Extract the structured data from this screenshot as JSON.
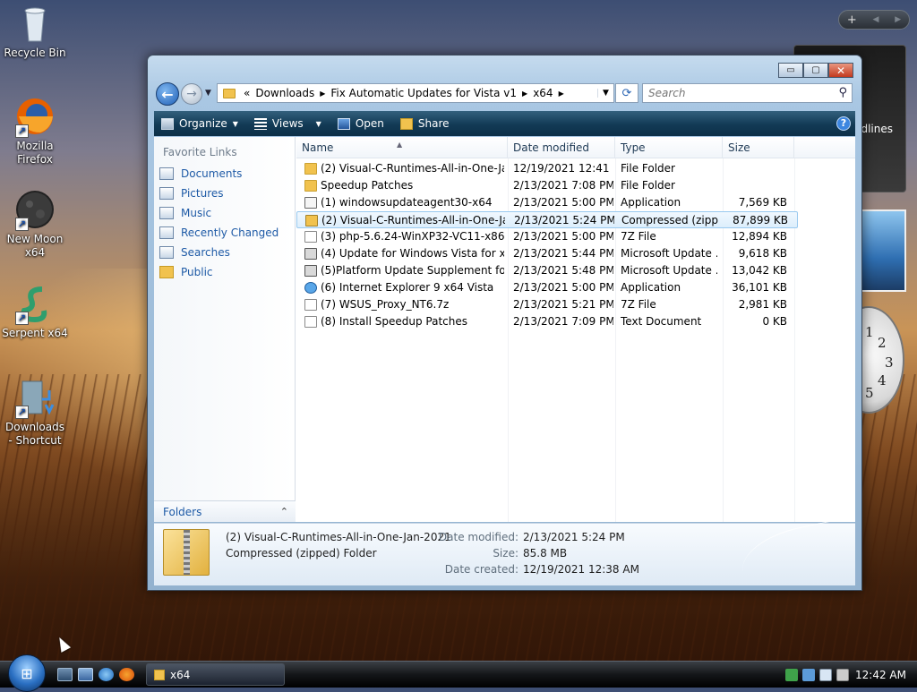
{
  "desktop": {
    "icons": [
      {
        "label": "Recycle Bin",
        "icon": "recycle-bin-icon"
      },
      {
        "label": "Mozilla Firefox",
        "icon": "firefox-icon"
      },
      {
        "label": "New Moon x64",
        "icon": "new-moon-icon"
      },
      {
        "label": "Serpent x64",
        "icon": "serpent-icon"
      },
      {
        "label": "Downloads - Shortcut",
        "icon": "downloads-shortcut-icon"
      }
    ],
    "gadget_text": "dlines",
    "clock_numbers": [
      "1",
      "2",
      "3",
      "4",
      "5"
    ]
  },
  "window": {
    "title_buttons": {
      "minimize": "▭",
      "maximize": "▢",
      "close": "✕"
    },
    "address": {
      "prefix": "«",
      "crumbs": [
        "Downloads",
        "Fix Automatic Updates for Vista v1",
        "x64"
      ]
    },
    "search_placeholder": "Search",
    "toolbar": {
      "organize": "Organize",
      "views": "Views",
      "open": "Open",
      "share": "Share",
      "help": "?"
    },
    "nav_pane": {
      "header": "Favorite Links",
      "links": [
        "Documents",
        "Pictures",
        "Music",
        "Recently Changed",
        "Searches",
        "Public"
      ],
      "folders_label": "Folders"
    },
    "columns": {
      "name": "Name",
      "date": "Date modified",
      "type": "Type",
      "size": "Size"
    },
    "files": [
      {
        "name": "(2) Visual-C-Runtimes-All-in-One-Ja...",
        "date": "12/19/2021 12:41 ...",
        "type": "File Folder",
        "size": "",
        "icon": "folder"
      },
      {
        "name": "Speedup Patches",
        "date": "2/13/2021 7:08 PM",
        "type": "File Folder",
        "size": "",
        "icon": "folder"
      },
      {
        "name": "(1) windowsupdateagent30-x64",
        "date": "2/13/2021 5:00 PM",
        "type": "Application",
        "size": "7,569 KB",
        "icon": "app"
      },
      {
        "name": "(2) Visual-C-Runtimes-All-in-One-Ja...",
        "date": "2/13/2021 5:24 PM",
        "type": "Compressed (zipp...",
        "size": "87,899 KB",
        "icon": "zip",
        "selected": true
      },
      {
        "name": "(3) php-5.6.24-WinXP32-VC11-x86.7z",
        "date": "2/13/2021 5:00 PM",
        "type": "7Z File",
        "size": "12,894 KB",
        "icon": "7z"
      },
      {
        "name": "(4) Update for Windows Vista for x64-...",
        "date": "2/13/2021 5:44 PM",
        "type": "Microsoft Update ...",
        "size": "9,618 KB",
        "icon": "msu"
      },
      {
        "name": "(5)Platform Update Supplement for ...",
        "date": "2/13/2021 5:48 PM",
        "type": "Microsoft Update ...",
        "size": "13,042 KB",
        "icon": "msu"
      },
      {
        "name": "(6) Internet Explorer 9 x64 Vista",
        "date": "2/13/2021 5:00 PM",
        "type": "Application",
        "size": "36,101 KB",
        "icon": "ie"
      },
      {
        "name": "(7) WSUS_Proxy_NT6.7z",
        "date": "2/13/2021 5:21 PM",
        "type": "7Z File",
        "size": "2,981 KB",
        "icon": "7z"
      },
      {
        "name": "(8) Install Speedup Patches",
        "date": "2/13/2021 7:09 PM",
        "type": "Text Document",
        "size": "0 KB",
        "icon": "txt"
      }
    ],
    "details": {
      "name": "(2) Visual-C-Runtimes-All-in-One-Jan-2021",
      "kind": "Compressed (zipped) Folder",
      "date_modified_label": "Date modified:",
      "date_modified": "2/13/2021 5:24 PM",
      "size_label": "Size:",
      "size": "85.8 MB",
      "date_created_label": "Date created:",
      "date_created": "12/19/2021 12:38 AM"
    }
  },
  "taskbar": {
    "task_label": "x64",
    "clock": "12:42 AM"
  },
  "colors": {
    "toolbar": "#123a55",
    "link": "#1e5aa6",
    "selection": "#dceefc"
  }
}
